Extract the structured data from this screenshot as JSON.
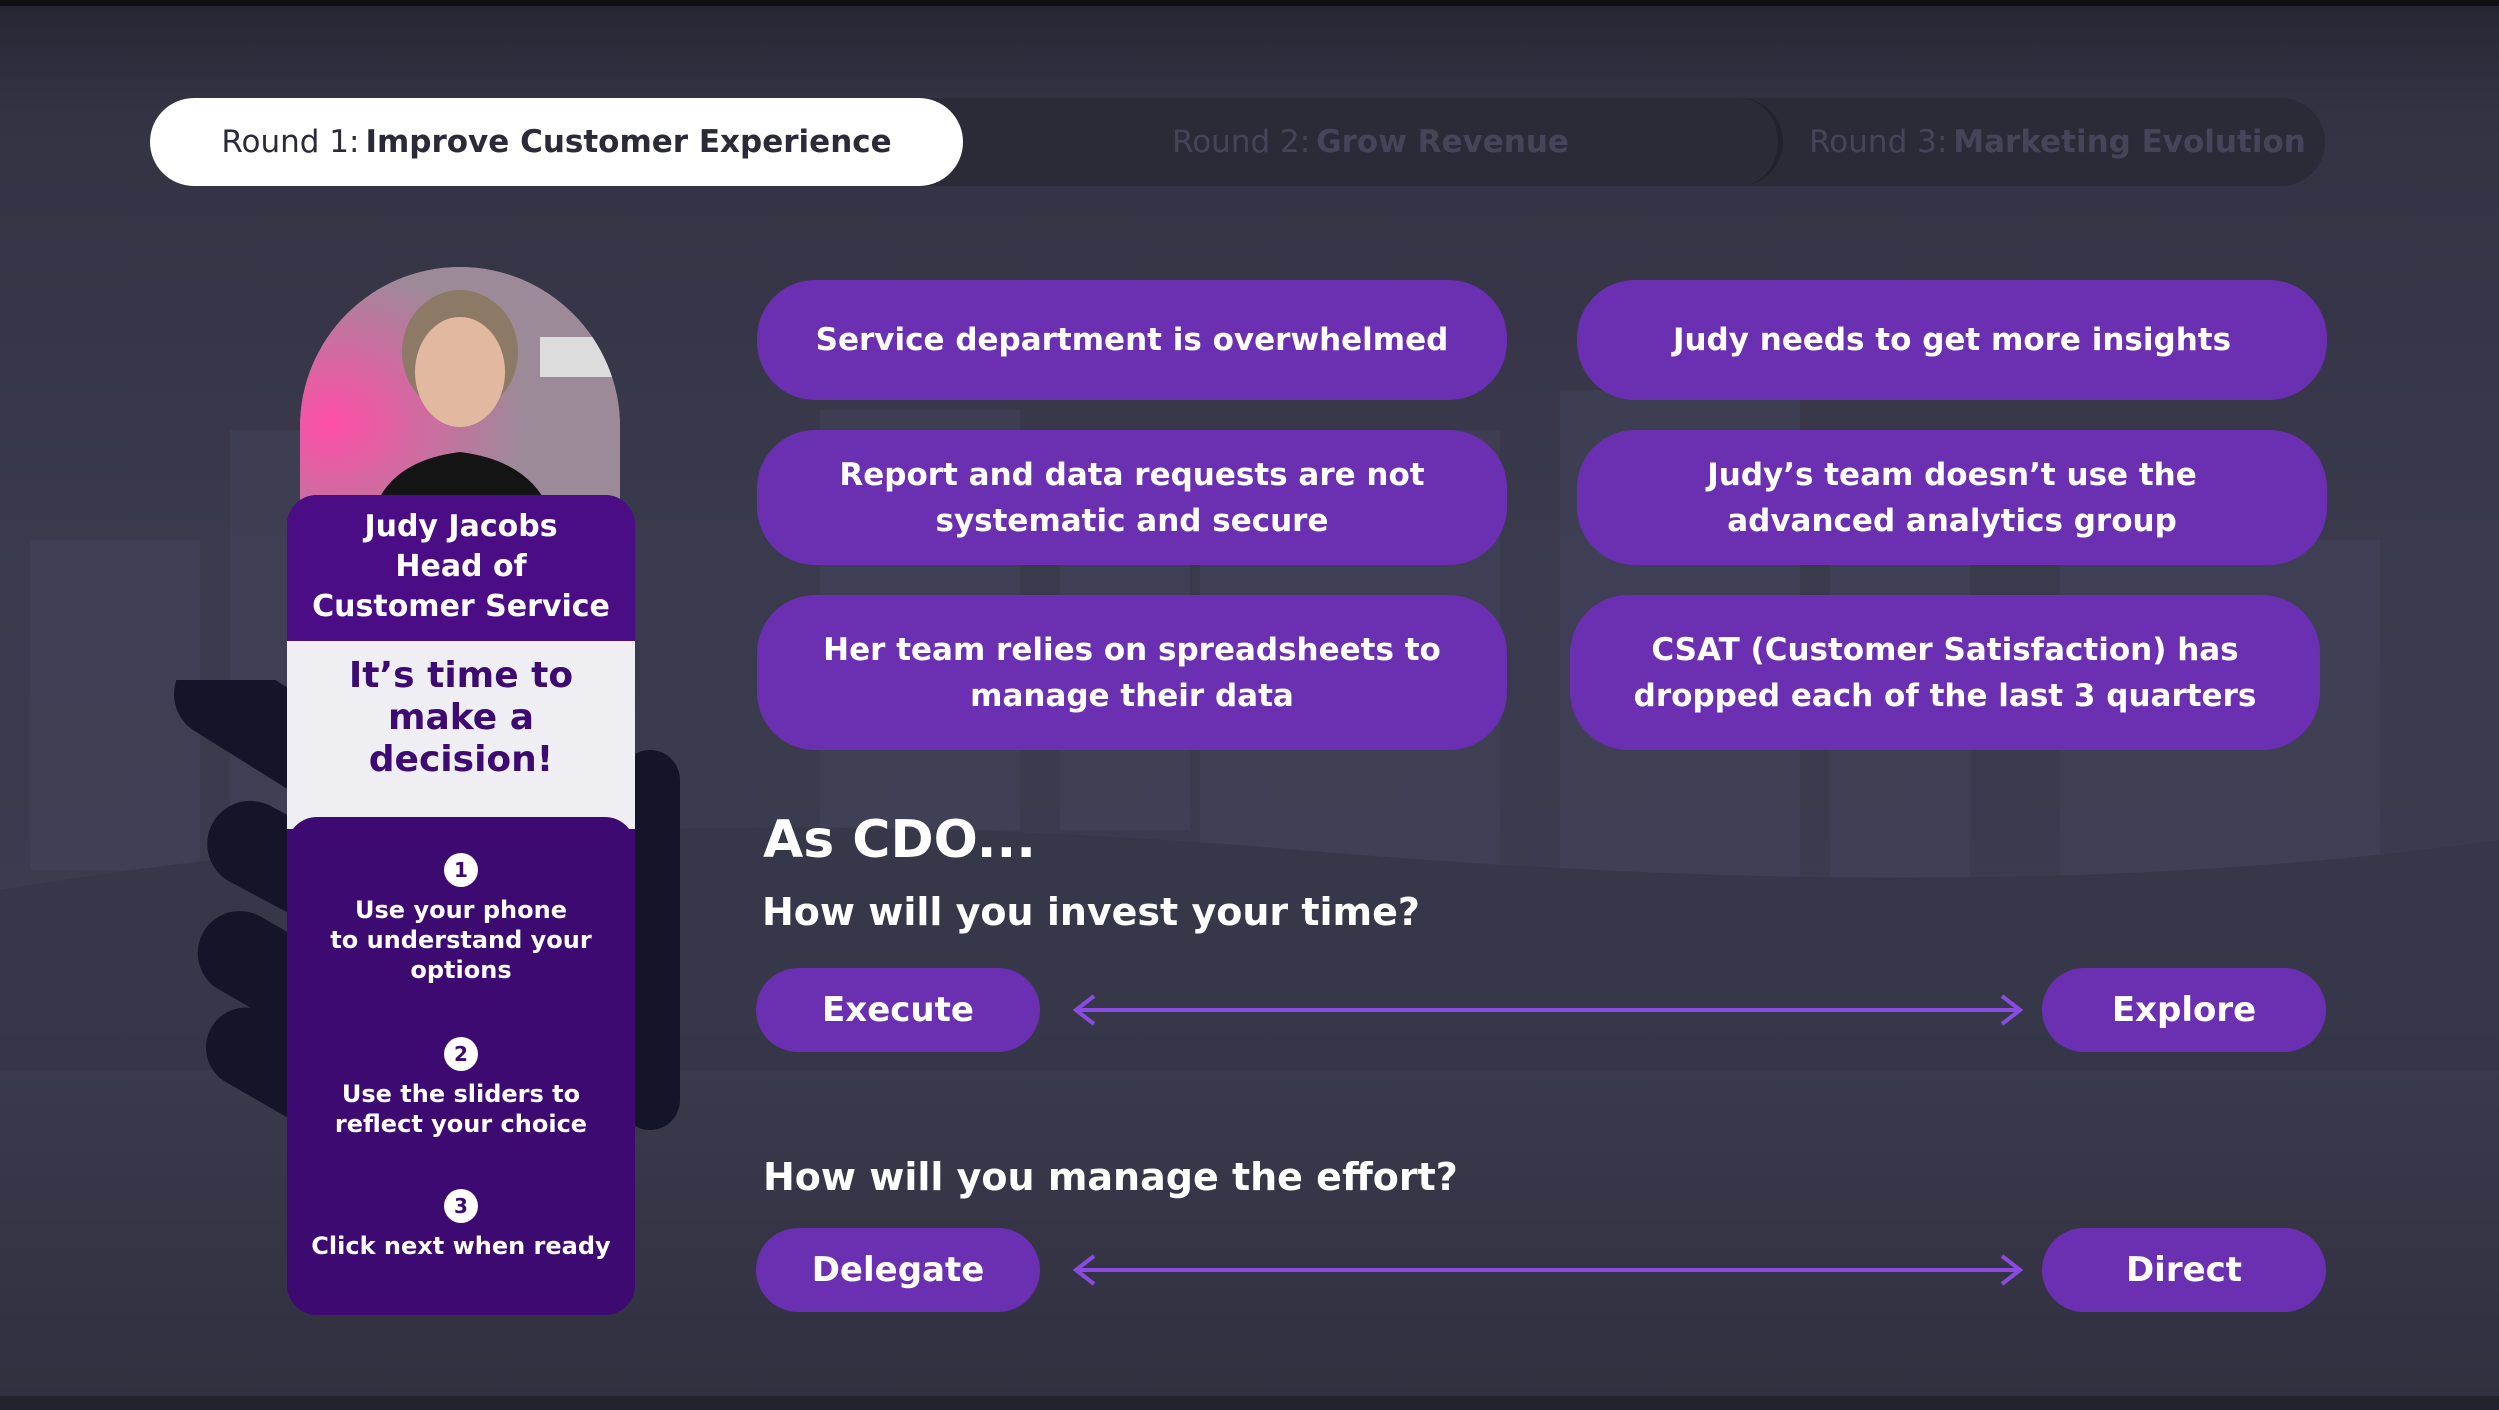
{
  "tabs": [
    {
      "prefix": "Round 1:",
      "title": "Improve Customer Experience",
      "active": true
    },
    {
      "prefix": "Round 2:",
      "title": "Grow Revenue",
      "active": false
    },
    {
      "prefix": "Round 3:",
      "title": "Marketing Evolution",
      "active": false
    }
  ],
  "persona": {
    "name": "Judy Jacobs",
    "role_line1": "Head of",
    "role_line2": "Customer Service",
    "prompt_line1": "It’s time to",
    "prompt_line2": "make a",
    "prompt_line3": "decision!"
  },
  "steps": [
    {
      "num": "1",
      "line1": "Use your phone",
      "line2": "to understand your",
      "line3": "options"
    },
    {
      "num": "2",
      "line1": "Use the sliders to",
      "line2": "reflect your choice"
    },
    {
      "num": "3",
      "line1": "Click next when ready"
    }
  ],
  "issues": {
    "left": [
      {
        "line1": "Service department is overwhelmed"
      },
      {
        "line1": "Report and data requests are not",
        "line2": "systematic and secure"
      },
      {
        "line1": "Her team relies on spreadsheets to",
        "line2": "manage their data"
      }
    ],
    "right": [
      {
        "line1": "Judy needs to get more insights"
      },
      {
        "line1": "Judy’s team doesn’t use the",
        "line2": "advanced analytics group"
      },
      {
        "line1": "CSAT (Customer Satisfaction) has",
        "line2": "dropped each of the last 3 quarters"
      }
    ]
  },
  "role_heading": "As CDO...",
  "questions": [
    {
      "text": "How will you invest your time?",
      "left": "Execute",
      "right": "Explore"
    },
    {
      "text": "How will you manage the effort?",
      "left": "Delegate",
      "right": "Direct"
    }
  ],
  "colors": {
    "accent": "#6b2fb2",
    "card": "#3d0a72",
    "background": "#3a3a4c"
  }
}
